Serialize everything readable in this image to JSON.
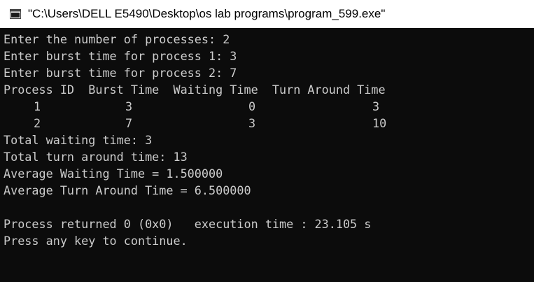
{
  "window": {
    "title": "\"C:\\Users\\DELL E5490\\Desktop\\os lab programs\\program_599.exe\"",
    "app_icon": "console-window-icon"
  },
  "console": {
    "background": "#0c0c0c",
    "foreground": "#cccccc",
    "prompt_lines": [
      "Enter the number of processes: 2",
      "Enter burst time for process 1: 3",
      "Enter burst time for process 2: 7"
    ],
    "table_header": "Process ID  Burst Time  Waiting Time  Turn Around Time",
    "table_rows": [
      {
        "process_id": "1",
        "burst_time": "3",
        "waiting_time": "0",
        "turnaround_time": "3"
      },
      {
        "process_id": "2",
        "burst_time": "7",
        "waiting_time": "3",
        "turnaround_time": "10"
      }
    ],
    "summary_lines": [
      "Total waiting time: 3",
      "Total turn around time: 13",
      "Average Waiting Time = 1.500000",
      "Average Turn Around Time = 6.500000"
    ],
    "return_line": "Process returned 0 (0x0)   execution time : 23.105 s",
    "continue_line": "Press any key to continue."
  }
}
